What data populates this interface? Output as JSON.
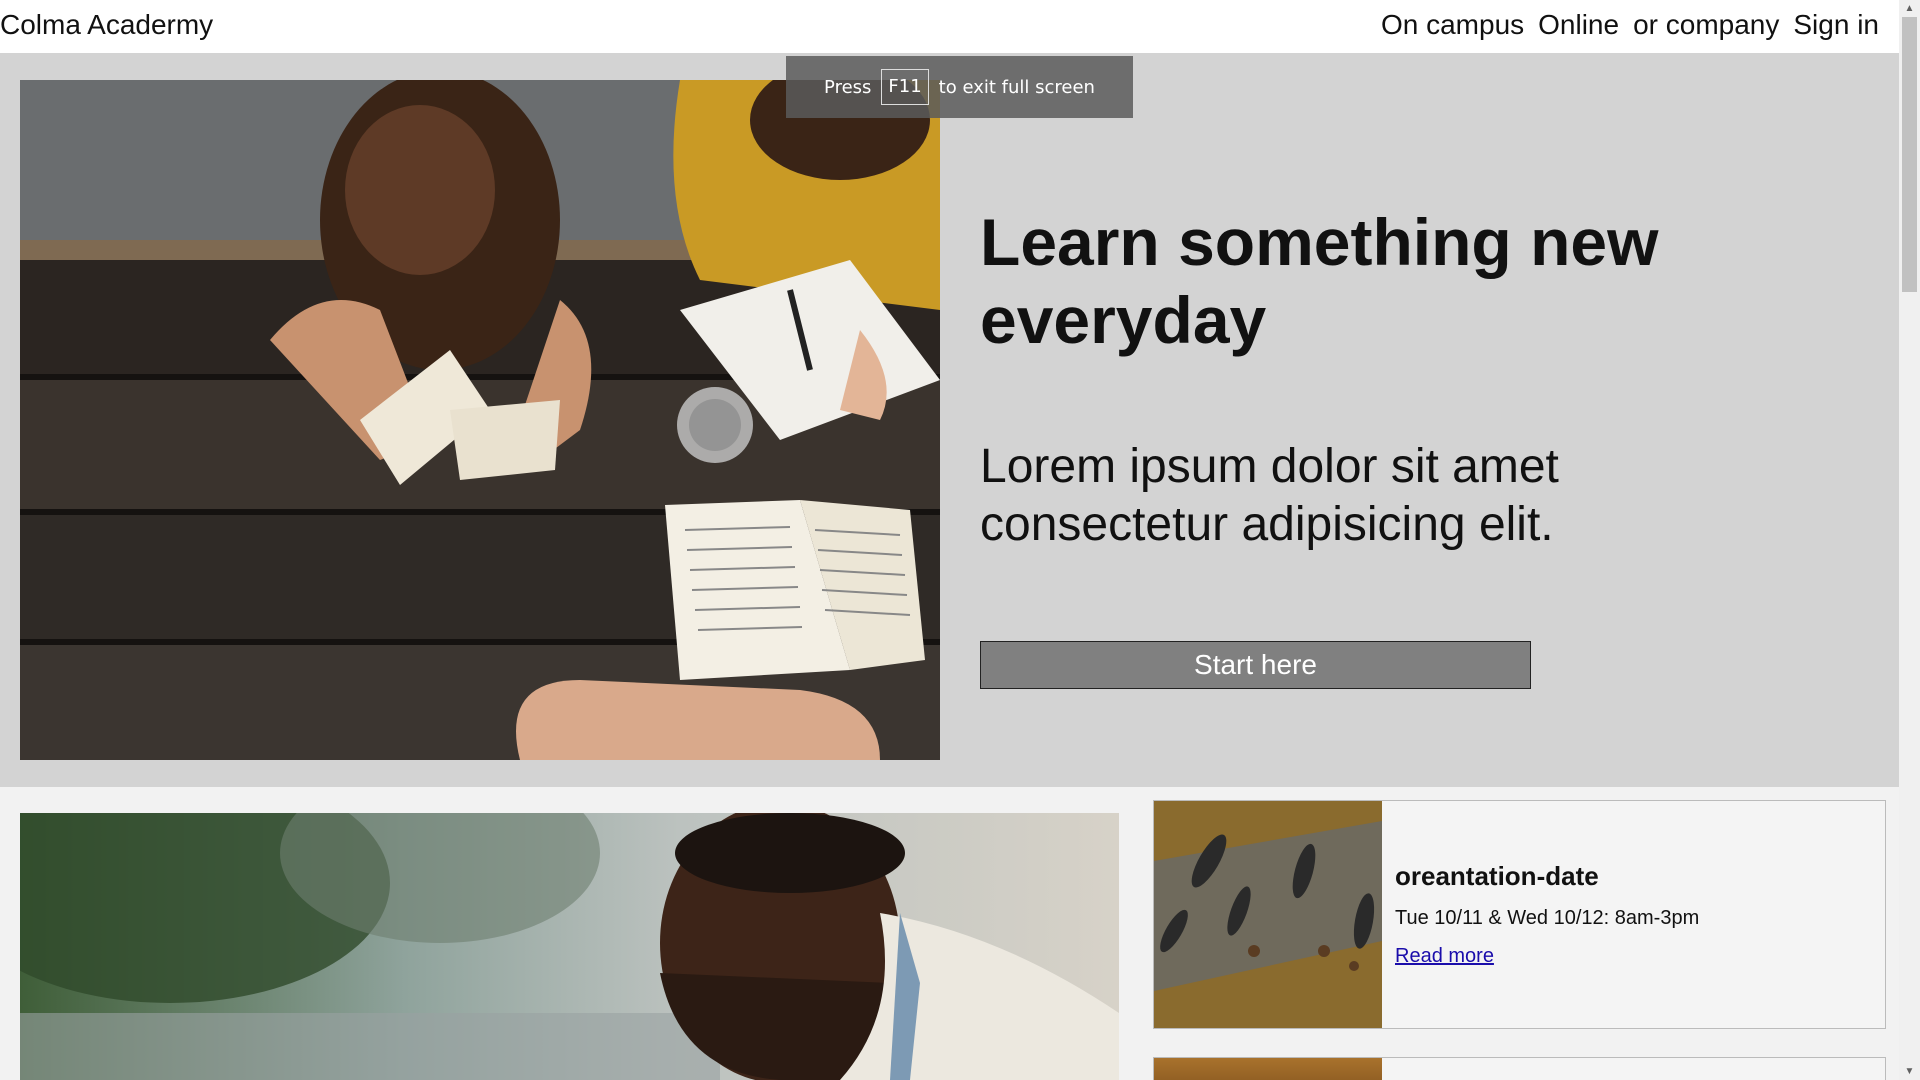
{
  "header": {
    "brand": "Colma Acadermy",
    "nav": [
      "On campus",
      "Online",
      "or company",
      "Sign in"
    ]
  },
  "fullscreen_toast": {
    "press": "Press",
    "key": "F11",
    "message": "to exit full screen"
  },
  "hero": {
    "title": "Learn something new everyday",
    "text": "Lorem ipsum dolor sit amet consectetur adipisicing elit.",
    "button": "Start here"
  },
  "events": [
    {
      "title": "oreantation-date",
      "date": "Tue 10/11 & Wed 10/12: 8am-3pm",
      "link": "Read more"
    }
  ],
  "colors": {
    "hero_bg": "#d3d3d3",
    "button_bg": "#808080",
    "link": "#1a0dab"
  }
}
